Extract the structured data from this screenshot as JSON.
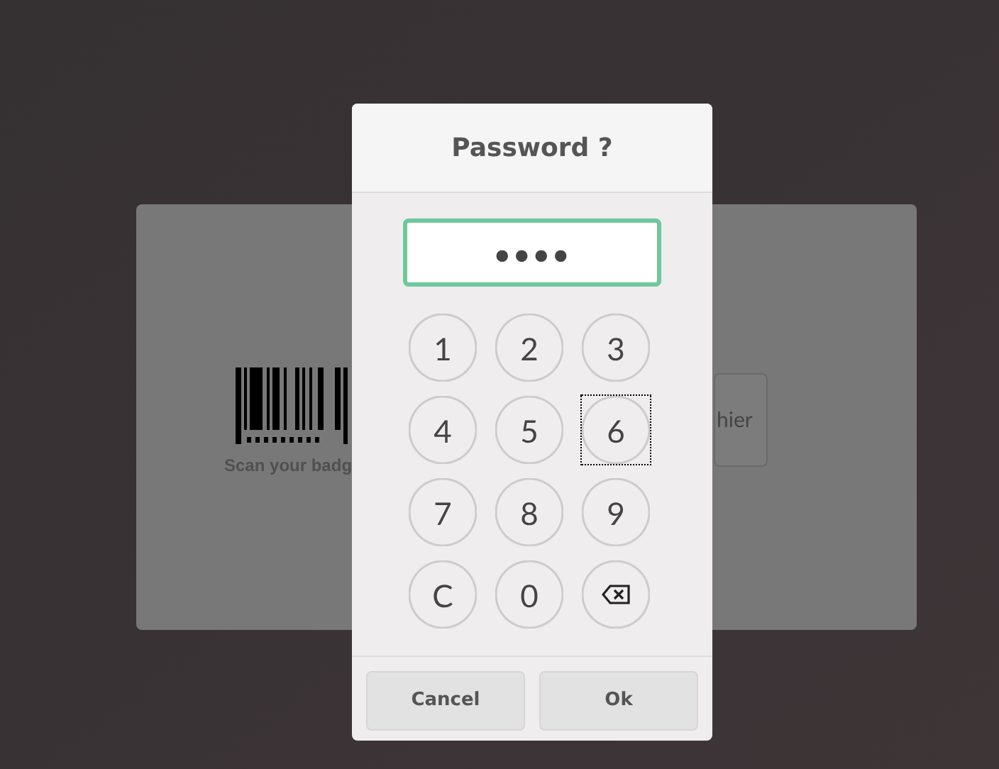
{
  "background": {
    "badge_caption": "Scan your badg",
    "button_label": "hier"
  },
  "dialog": {
    "title": "Password ?",
    "password": {
      "value": "••••"
    },
    "keys": [
      {
        "kind": "digit",
        "label": "1",
        "focused": false
      },
      {
        "kind": "digit",
        "label": "2",
        "focused": false
      },
      {
        "kind": "digit",
        "label": "3",
        "focused": false
      },
      {
        "kind": "digit",
        "label": "4",
        "focused": false
      },
      {
        "kind": "digit",
        "label": "5",
        "focused": false
      },
      {
        "kind": "digit",
        "label": "6",
        "focused": true
      },
      {
        "kind": "digit",
        "label": "7",
        "focused": false
      },
      {
        "kind": "digit",
        "label": "8",
        "focused": false
      },
      {
        "kind": "digit",
        "label": "9",
        "focused": false
      },
      {
        "kind": "clear",
        "label": "C",
        "focused": false
      },
      {
        "kind": "digit",
        "label": "0",
        "focused": false
      },
      {
        "kind": "backspace",
        "focused": false
      }
    ],
    "buttons": [
      {
        "label": "Cancel"
      },
      {
        "label": "Ok"
      }
    ]
  }
}
